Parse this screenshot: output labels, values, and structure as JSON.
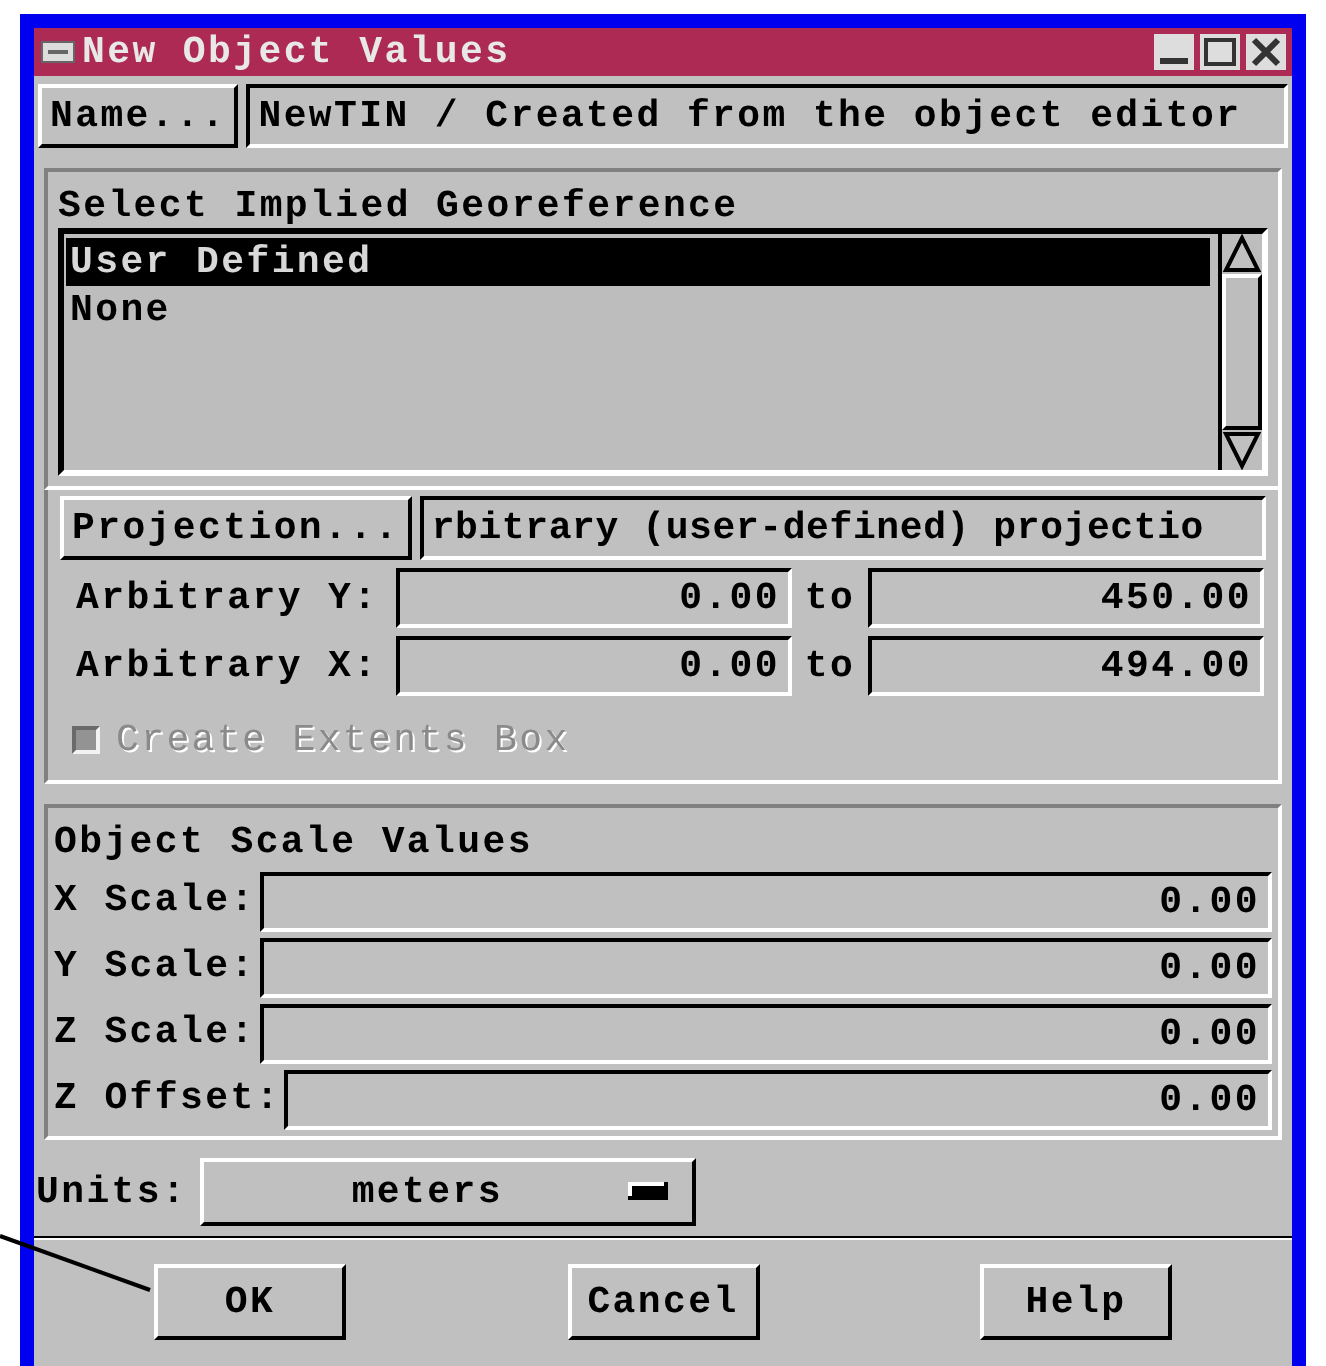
{
  "window": {
    "title": "New Object Values"
  },
  "name": {
    "button": "Name...",
    "value": "NewTIN / Created from the object editor"
  },
  "georeference": {
    "title": "Select Implied Georeference",
    "items": [
      {
        "label": "User Defined",
        "selected": true
      },
      {
        "label": "None",
        "selected": false
      }
    ]
  },
  "projection": {
    "button": "Projection...",
    "value": "rbitrary (user-defined) projectio"
  },
  "ranges": [
    {
      "label": "Arbitrary Y:",
      "from": "0.00",
      "to_label": "to",
      "to": "450.00"
    },
    {
      "label": "Arbitrary X:",
      "from": "0.00",
      "to_label": "to",
      "to": "494.00"
    }
  ],
  "extents_box": {
    "label": "Create Extents Box",
    "checked": false,
    "disabled": true
  },
  "scale": {
    "title": "Object Scale Values",
    "rows": [
      {
        "label": "X Scale:",
        "value": "0.00"
      },
      {
        "label": "Y Scale:",
        "value": "0.00"
      },
      {
        "label": "Z Scale:",
        "value": "0.00"
      },
      {
        "label": "Z Offset:",
        "value": "0.00"
      }
    ]
  },
  "units": {
    "label": "Units:",
    "value": "meters"
  },
  "buttons": [
    "OK",
    "Cancel",
    "Help"
  ]
}
